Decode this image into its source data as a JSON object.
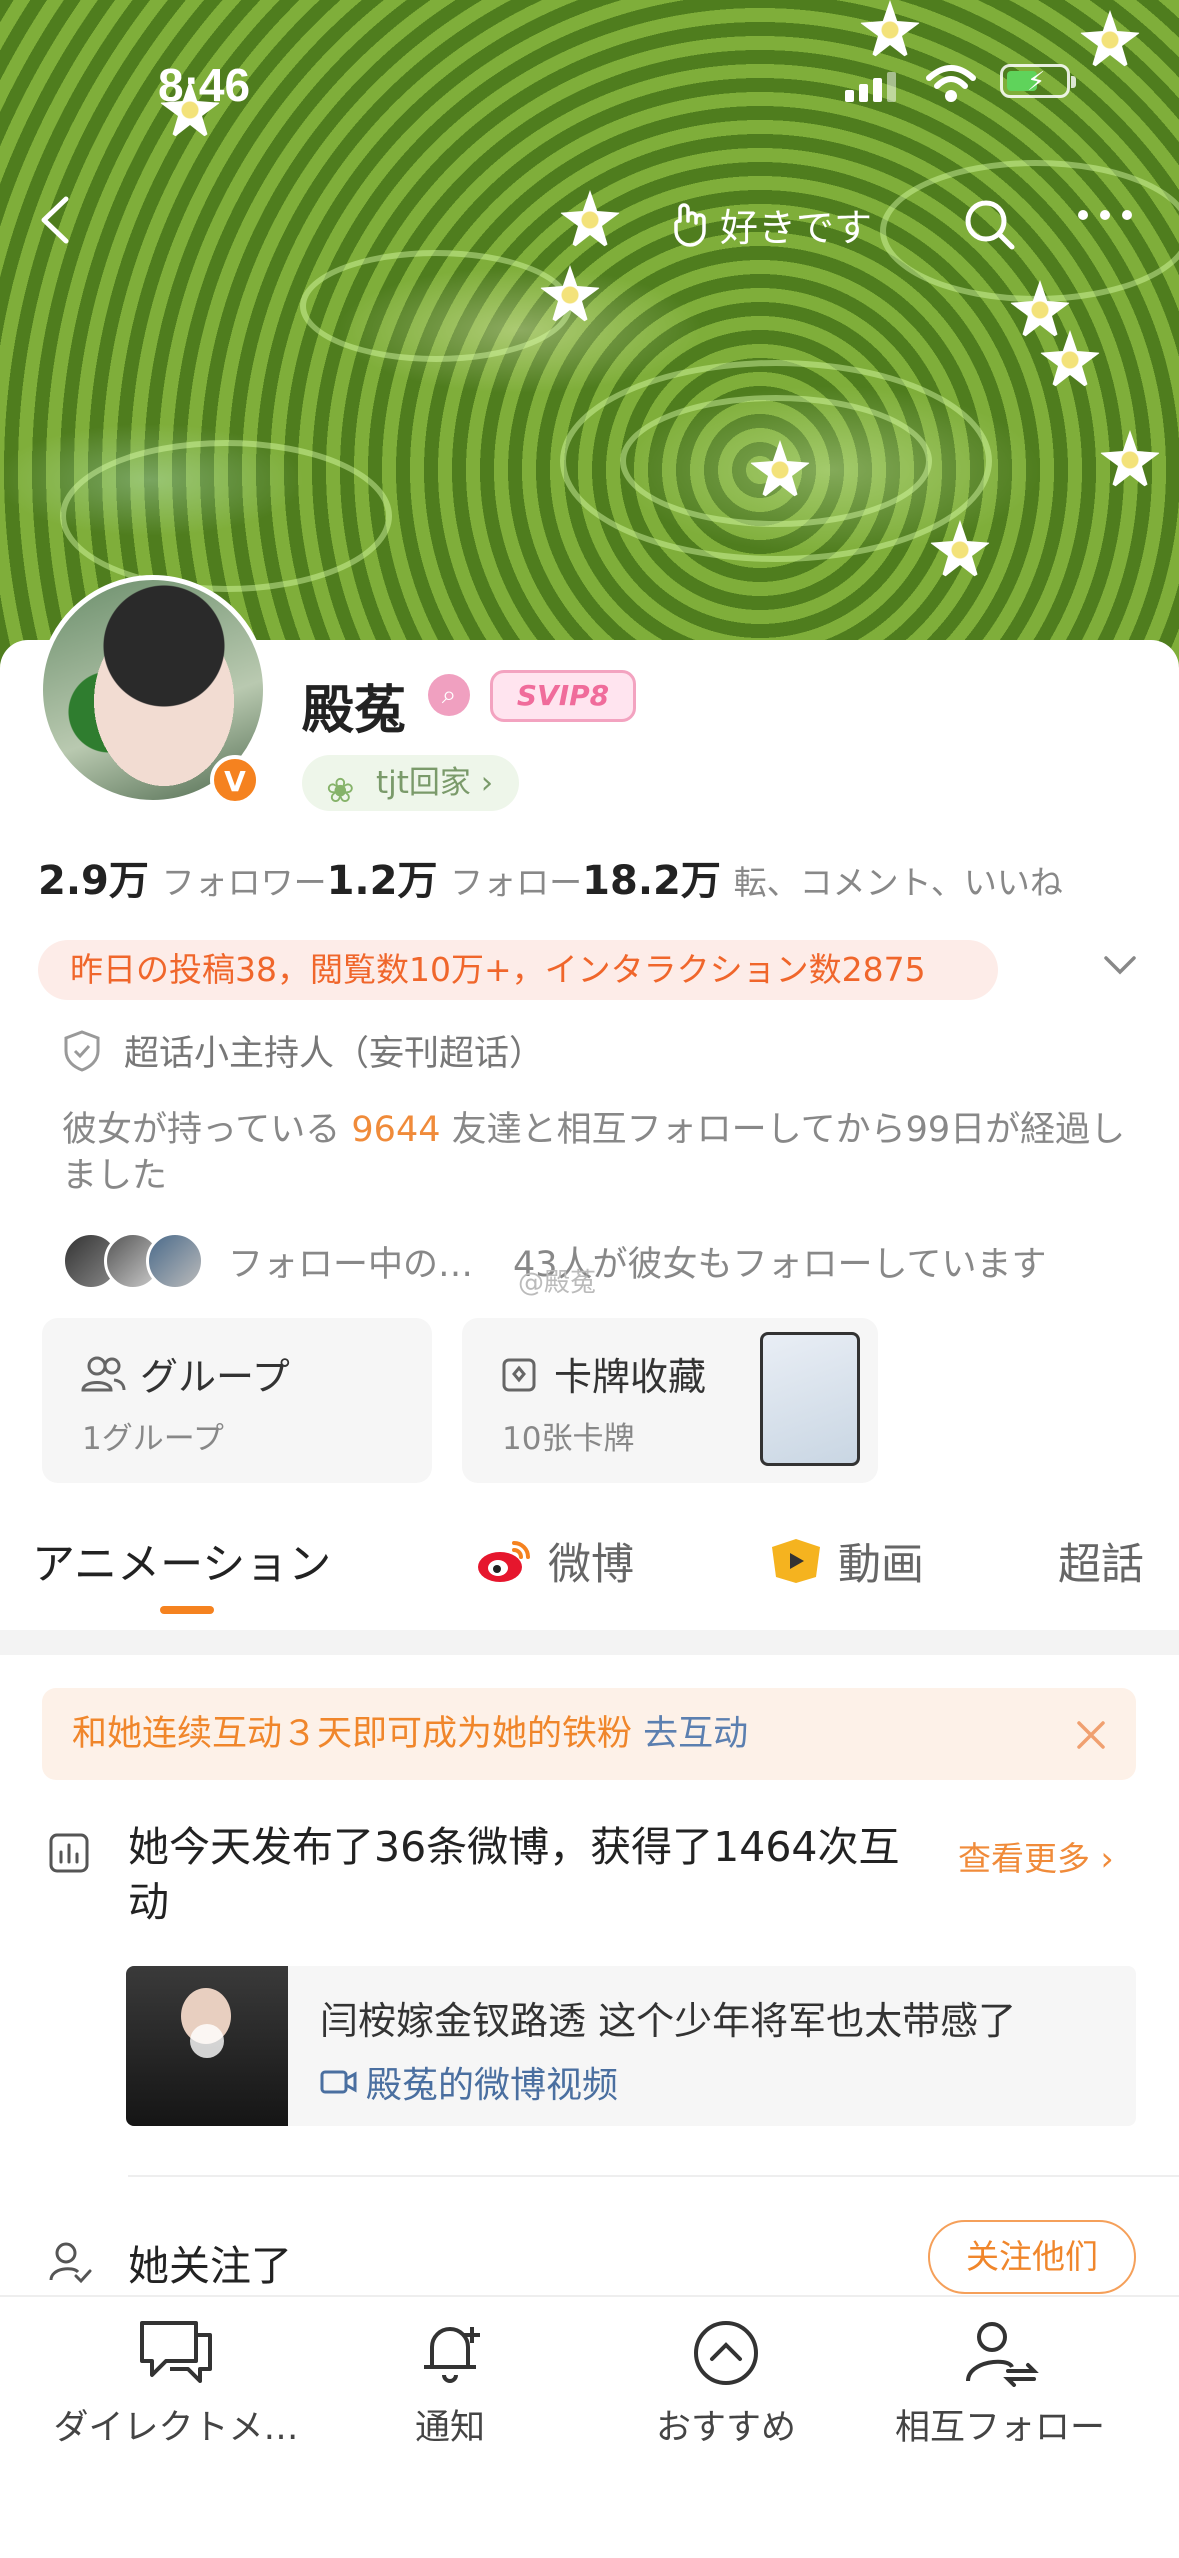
{
  "status_bar": {
    "time": "8:46"
  },
  "top_nav": {
    "like_label": "好きです"
  },
  "profile": {
    "name": "殿菟",
    "vip_badge": "SVIP8",
    "verified_badge": "V",
    "chip_label": "tjt回家 ›",
    "stats": {
      "followers_value": "2.9万",
      "followers_label": "フォロワー",
      "following_value": "1.2万",
      "following_label": "フォロー",
      "interactions_value": "18.2万",
      "interactions_label": "転、コメント、いいね"
    },
    "activity_pill": "昨日の投稿38，閲覧数10万+，インタラクション数2875",
    "host_label": "超话小主持人（妄刊超话）",
    "description_prefix": "彼女が持っている",
    "description_number": "9644",
    "description_suffix": "友達と相互フォローしてから99日が経過しました",
    "mutual_text_1": "フォロー中の…",
    "mutual_text_2": "43人が彼女もフォローしています",
    "watermark": "@殿菟"
  },
  "tiles": {
    "group_title": "グループ",
    "group_sub": "1グループ",
    "cards_title": "卡牌收藏",
    "cards_sub": "10张卡牌"
  },
  "tabs": [
    {
      "label": "アニメーション"
    },
    {
      "label": "微博"
    },
    {
      "label": "動画"
    },
    {
      "label": "超話"
    }
  ],
  "feed": {
    "notice_text": "和她连续互动３天即可成为她的铁粉",
    "notice_link": "去互动",
    "summary": "她今天发布了36条微博，获得了1464次互动",
    "see_more": "查看更多 ›",
    "video_title": "闫桉嫁金钗路透 这个少年将军也太带感了",
    "video_source": "殿菟的微博视频",
    "followed_label": "她关注了",
    "follow_them_button": "关注他们"
  },
  "bottom_bar": [
    {
      "label": "ダイレクトメ…",
      "icon": "chat-icon"
    },
    {
      "label": "通知",
      "icon": "bell-icon"
    },
    {
      "label": "おすすめ",
      "icon": "chevron-up-icon"
    },
    {
      "label": "相互フォロー",
      "icon": "mutual-follow-icon"
    }
  ],
  "colors": {
    "accent": "#f5821f",
    "link": "#4a6fa0",
    "pill_text": "#f0662b"
  }
}
